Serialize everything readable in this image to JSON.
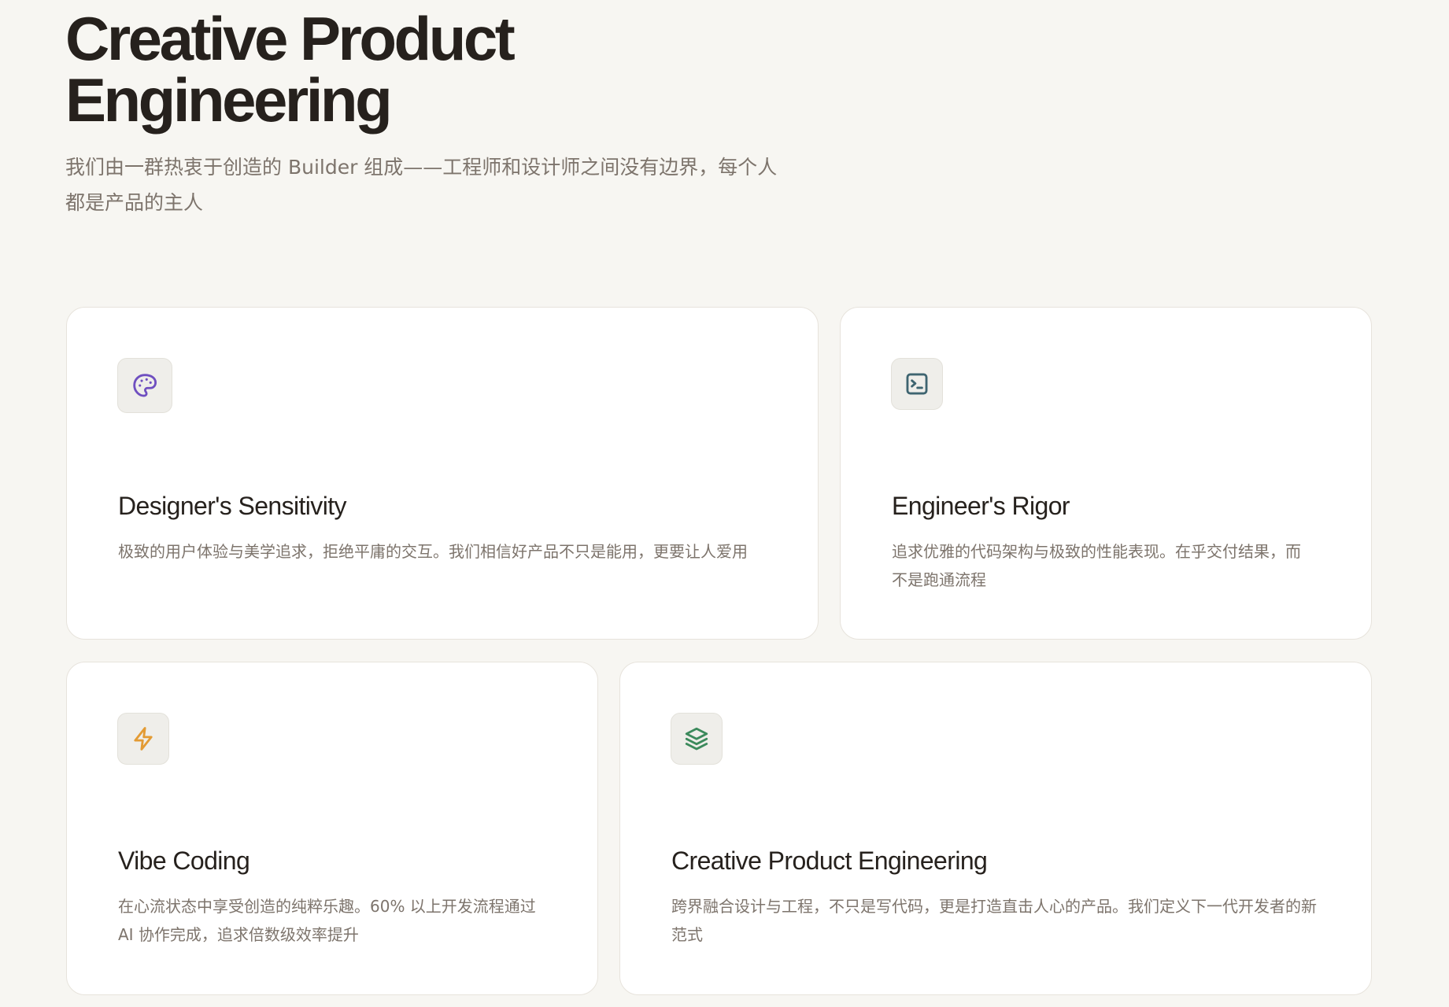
{
  "hero": {
    "title": "Creative Product\nEngineering",
    "subtitle": "我们由一群热衷于创造的 Builder 组成——工程师和设计师之间没有边界，每个人都是产品的主人"
  },
  "cards": [
    {
      "icon": "palette-icon",
      "icon_color": "#6f4fc0",
      "title": "Designer's Sensitivity",
      "description": "极致的用户体验与美学追求，拒绝平庸的交互。我们相信好产品不只是能用，更要让人爱用"
    },
    {
      "icon": "terminal-icon",
      "icon_color": "#3e6470",
      "title": "Engineer's Rigor",
      "description": "追求优雅的代码架构与极致的性能表现。在乎交付结果，而不是跑通流程"
    },
    {
      "icon": "lightning-icon",
      "icon_color": "#e39b34",
      "title": "Vibe Coding",
      "description": "在心流状态中享受创造的纯粹乐趣。60% 以上开发流程通过 AI 协作完成，追求倍数级效率提升"
    },
    {
      "icon": "layers-icon",
      "icon_color": "#3c8a5c",
      "title": "Creative Product Engineering",
      "description": "跨界融合设计与工程，不只是写代码，更是打造直击人心的产品。我们定义下一代开发者的新范式"
    }
  ]
}
